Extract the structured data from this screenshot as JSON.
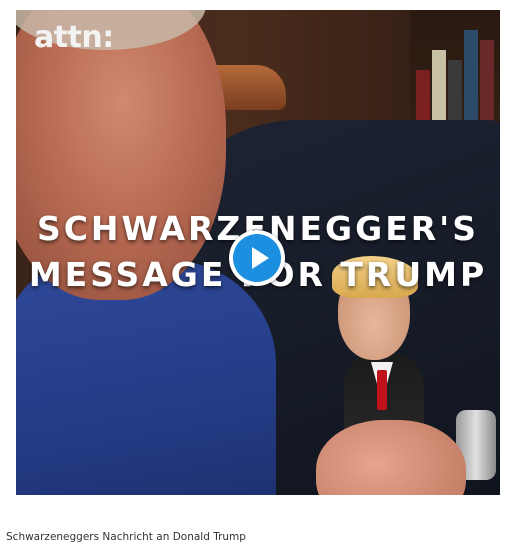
{
  "video": {
    "brand": "attn:",
    "headline_line1": "SCHWARZENEGGER'S",
    "headline_line2": "MESSAGE FOR TRUMP",
    "play_icon": "play-icon",
    "accent_color": "#1d8fe0"
  },
  "caption": {
    "text": "Schwarzeneggers Nachricht an Donald Trump"
  }
}
